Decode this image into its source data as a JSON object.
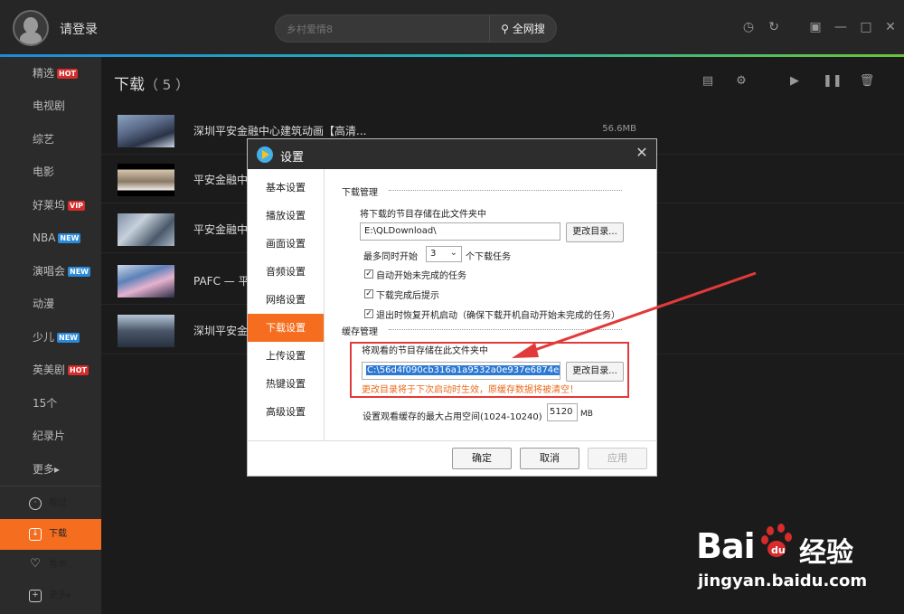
{
  "topbar": {
    "login": "请登录",
    "search_placeholder": "乡村爱情8",
    "search_button": "全网搜"
  },
  "sidebar": {
    "items": [
      {
        "label": "精选",
        "badge": "HOT"
      },
      {
        "label": "电视剧",
        "badge": ""
      },
      {
        "label": "综艺",
        "badge": ""
      },
      {
        "label": "电影",
        "badge": ""
      },
      {
        "label": "好莱坞",
        "badge": "VIP"
      },
      {
        "label": "NBA",
        "badge": "NEW"
      },
      {
        "label": "演唱会",
        "badge": "NEW"
      },
      {
        "label": "动漫",
        "badge": ""
      },
      {
        "label": "少儿",
        "badge": "NEW"
      },
      {
        "label": "英美剧",
        "badge": "HOT"
      },
      {
        "label": "15个",
        "badge": ""
      },
      {
        "label": "纪录片",
        "badge": ""
      },
      {
        "label": "更多▸",
        "badge": ""
      }
    ],
    "bottom": [
      {
        "label": "看过",
        "icon": "clock-icon"
      },
      {
        "label": "下载",
        "icon": "download-icon"
      },
      {
        "label": "看单",
        "icon": "heart-plus-icon"
      },
      {
        "label": "更多▸",
        "icon": "plus-icon"
      }
    ]
  },
  "main": {
    "title": "下载",
    "count": "（ 5 ）",
    "rows": [
      {
        "title": "深圳平安金融中心建筑动画【高清...",
        "size": "56.6MB"
      },
      {
        "title": "平安金融中",
        "size": ""
      },
      {
        "title": "平安金融中",
        "size": ""
      },
      {
        "title": "PAFC — 平安",
        "size": ""
      },
      {
        "title": "深圳平安金",
        "size": ""
      }
    ]
  },
  "dialog": {
    "title": "设置",
    "tabs": [
      "基本设置",
      "播放设置",
      "画面设置",
      "音频设置",
      "网络设置",
      "下载设置",
      "上传设置",
      "热键设置",
      "高级设置"
    ],
    "active_tab": "下载设置",
    "download": {
      "section": "下载管理",
      "store_label": "将下载的节目存储在此文件夹中",
      "path": "E:\\QLDownload\\",
      "change_btn": "更改目录...",
      "max_prefix": "最多同时开始",
      "max_value": "3",
      "max_suffix": "个下载任务",
      "opt1": "自动开始未完成的任务",
      "opt2": "下载完成后提示",
      "opt3": "退出时恢复开机启动（确保下载开机自动开始未完成的任务）"
    },
    "cache": {
      "section": "缓存管理",
      "store_label": "将观看的节目存储在此文件夹中",
      "path": "C:\\56d4f090cb316a1a9532a0e937e6874e",
      "change_btn": "更改目录...",
      "warning": "更改目录将于下次启动时生效，原缓存数据将被清空！",
      "max_label": "设置观看缓存的最大占用空间(1024-10240)",
      "max_value": "5120",
      "unit": "MB"
    },
    "footer": {
      "ok": "确定",
      "cancel": "取消",
      "apply": "应用"
    }
  },
  "watermark": {
    "brand": "Bai",
    "brand_cn": "经验",
    "url": "jingyan.baidu.com"
  }
}
